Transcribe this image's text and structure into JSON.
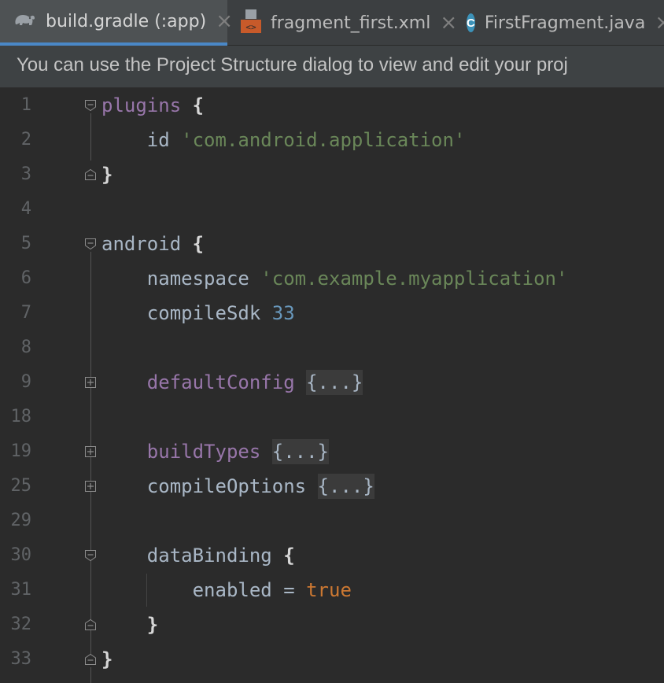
{
  "tabs": [
    {
      "label": "build.gradle (:app)",
      "icon": "gradle-elephant-icon",
      "active": true
    },
    {
      "label": "fragment_first.xml",
      "icon": "xml-layout-icon",
      "active": false
    },
    {
      "label": "FirstFragment.java",
      "icon": "java-class-icon",
      "icon_letter": "C",
      "active": false
    }
  ],
  "close_glyph": "×",
  "banner": {
    "text": "You can use the Project Structure dialog to view and edit your proj"
  },
  "code": {
    "lines": [
      {
        "num": "1",
        "parts": [
          {
            "t": "plugins",
            "c": "kw"
          },
          {
            "t": " "
          },
          {
            "t": "{",
            "c": "brace"
          }
        ]
      },
      {
        "num": "2",
        "parts": [
          {
            "t": "    id ",
            "c": "plain"
          },
          {
            "t": "'com.android.application'",
            "c": "str"
          }
        ]
      },
      {
        "num": "3",
        "parts": [
          {
            "t": "}",
            "c": "brace"
          }
        ]
      },
      {
        "num": "4",
        "parts": []
      },
      {
        "num": "5",
        "parts": [
          {
            "t": "android ",
            "c": "plain"
          },
          {
            "t": "{",
            "c": "brace"
          }
        ]
      },
      {
        "num": "6",
        "parts": [
          {
            "t": "    namespace ",
            "c": "plain"
          },
          {
            "t": "'com.example.myapplication'",
            "c": "str"
          }
        ]
      },
      {
        "num": "7",
        "parts": [
          {
            "t": "    compileSdk ",
            "c": "plain"
          },
          {
            "t": "33",
            "c": "num"
          }
        ]
      },
      {
        "num": "8",
        "parts": []
      },
      {
        "num": "9",
        "parts": [
          {
            "t": "    "
          },
          {
            "t": "defaultConfig",
            "c": "kw"
          },
          {
            "t": " "
          },
          {
            "t": "{...}",
            "c": "folded"
          }
        ]
      },
      {
        "num": "18",
        "parts": []
      },
      {
        "num": "19",
        "parts": [
          {
            "t": "    "
          },
          {
            "t": "buildTypes",
            "c": "kw"
          },
          {
            "t": " "
          },
          {
            "t": "{...}",
            "c": "folded"
          }
        ]
      },
      {
        "num": "25",
        "parts": [
          {
            "t": "    compileOptions ",
            "c": "plain"
          },
          {
            "t": "{...}",
            "c": "folded"
          }
        ]
      },
      {
        "num": "29",
        "parts": []
      },
      {
        "num": "30",
        "parts": [
          {
            "t": "    dataBinding ",
            "c": "plain"
          },
          {
            "t": "{",
            "c": "brace"
          }
        ]
      },
      {
        "num": "31",
        "parts": [
          {
            "t": "        enabled = ",
            "c": "plain"
          },
          {
            "t": "true",
            "c": "bool"
          }
        ]
      },
      {
        "num": "32",
        "parts": [
          {
            "t": "    "
          },
          {
            "t": "}",
            "c": "brace"
          }
        ]
      },
      {
        "num": "33",
        "parts": [
          {
            "t": "}",
            "c": "brace"
          }
        ]
      }
    ],
    "fold_markers": {
      "1": "fold-open",
      "3": "fold-close",
      "5": "fold-open",
      "9": "fold-expand",
      "19": "fold-expand",
      "25": "fold-expand",
      "30": "fold-open",
      "32": "fold-close",
      "33": "fold-close"
    }
  }
}
